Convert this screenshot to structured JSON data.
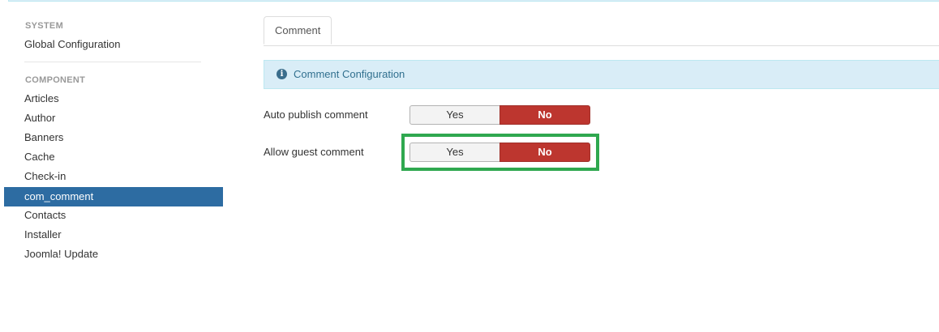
{
  "sidebar": {
    "system_header": "SYSTEM",
    "system_items": [
      {
        "label": "Global Configuration"
      }
    ],
    "component_header": "COMPONENT",
    "component_items": [
      {
        "label": "Articles"
      },
      {
        "label": "Author"
      },
      {
        "label": "Banners"
      },
      {
        "label": "Cache"
      },
      {
        "label": "Check-in"
      },
      {
        "label": "com_comment"
      },
      {
        "label": "Contacts"
      },
      {
        "label": "Installer"
      },
      {
        "label": "Joomla! Update"
      }
    ],
    "active_item": "com_comment"
  },
  "main": {
    "tabs": [
      {
        "label": "Comment"
      }
    ],
    "alert": {
      "icon": "info-circle-icon",
      "text": "Comment Configuration"
    },
    "fields": [
      {
        "label": "Auto publish comment",
        "options": [
          "Yes",
          "No"
        ],
        "selected": "No"
      },
      {
        "label": "Allow guest comment",
        "options": [
          "Yes",
          "No"
        ],
        "selected": "No"
      }
    ]
  },
  "colors": {
    "active_nav_bg": "#2d6ca2",
    "alert_bg": "#d9edf7",
    "alert_text": "#31708f",
    "switch_no_bg": "#bd362f",
    "highlight_border": "#2fa84f"
  }
}
